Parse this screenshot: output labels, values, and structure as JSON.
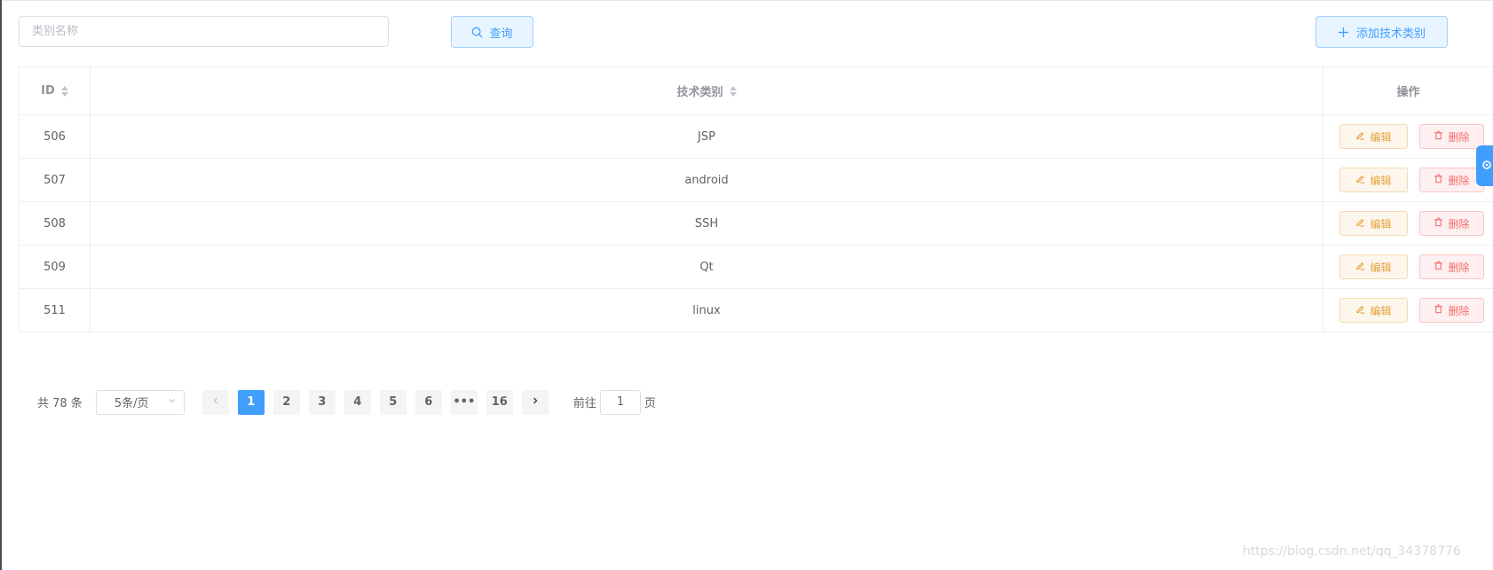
{
  "search": {
    "placeholder": "类别名称",
    "value": ""
  },
  "toolbar": {
    "query_label": "查询",
    "add_label": "添加技术类别"
  },
  "table": {
    "columns": {
      "id": "ID",
      "type": "技术类别",
      "ops": "操作"
    },
    "rows": [
      {
        "id": "506",
        "type": "JSP",
        "edit": "编辑",
        "delete": "删除"
      },
      {
        "id": "507",
        "type": "android",
        "edit": "编辑",
        "delete": "删除"
      },
      {
        "id": "508",
        "type": "SSH",
        "edit": "编辑",
        "delete": "删除"
      },
      {
        "id": "509",
        "type": "Qt",
        "edit": "编辑",
        "delete": "删除"
      },
      {
        "id": "511",
        "type": "linux",
        "edit": "编辑",
        "delete": "删除"
      }
    ]
  },
  "pagination": {
    "total": "共 78 条",
    "page_size": "5条/页",
    "pages": [
      "1",
      "2",
      "3",
      "4",
      "5",
      "6"
    ],
    "ellipsis": "•••",
    "last_page": "16",
    "current_page": "1",
    "goto_prefix": "前往",
    "goto_value": "1",
    "goto_suffix": "页"
  },
  "watermark": "https://blog.csdn.net/qq_34378776",
  "colors": {
    "primary": "#409eff",
    "warning": "#e6a23c",
    "danger": "#f56c6c"
  }
}
